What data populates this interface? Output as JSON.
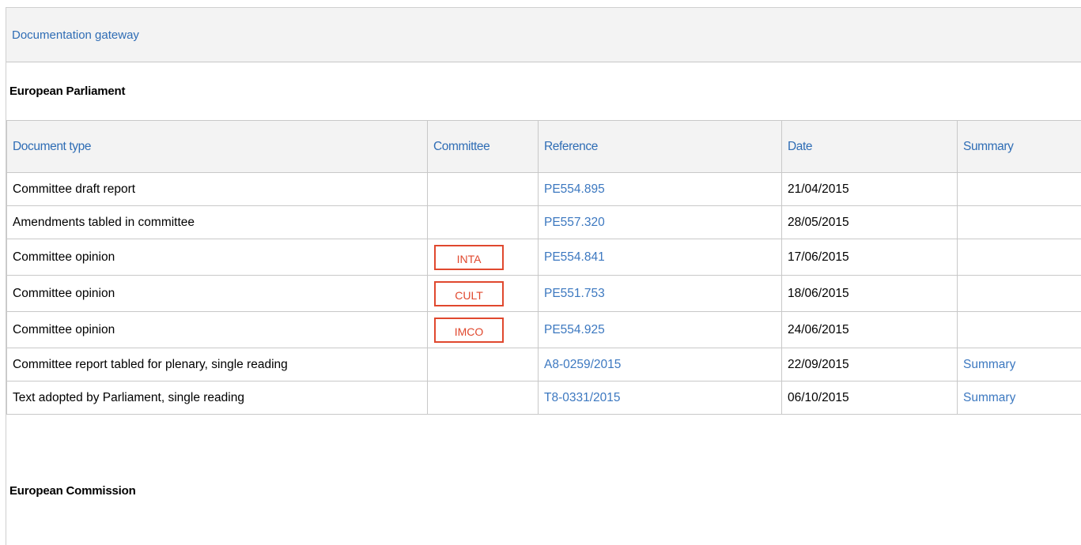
{
  "gateway": {
    "title": "Documentation gateway"
  },
  "european_parliament": {
    "title": "European Parliament",
    "columns": {
      "document_type": "Document type",
      "committee": "Committee",
      "reference": "Reference",
      "date": "Date",
      "summary": "Summary"
    },
    "rows": [
      {
        "document_type": "Committee draft report",
        "committee": "",
        "reference": "PE554.895",
        "date": "21/04/2015",
        "summary": ""
      },
      {
        "document_type": "Amendments tabled in committee",
        "committee": "",
        "reference": "PE557.320",
        "date": "28/05/2015",
        "summary": ""
      },
      {
        "document_type": "Committee opinion",
        "committee": "INTA",
        "reference": "PE554.841",
        "date": "17/06/2015",
        "summary": ""
      },
      {
        "document_type": "Committee opinion",
        "committee": "CULT",
        "reference": "PE551.753",
        "date": "18/06/2015",
        "summary": ""
      },
      {
        "document_type": "Committee opinion",
        "committee": "IMCO",
        "reference": "PE554.925",
        "date": "24/06/2015",
        "summary": ""
      },
      {
        "document_type": "Committee report tabled for plenary, single reading",
        "committee": "",
        "reference": "A8-0259/2015",
        "date": "22/09/2015",
        "summary": "Summary"
      },
      {
        "document_type": "Text adopted by Parliament, single reading",
        "committee": "",
        "reference": "T8-0331/2015",
        "date": "06/10/2015",
        "summary": "Summary"
      }
    ]
  },
  "european_commission": {
    "title": "European Commission"
  },
  "colors": {
    "link": "#2f6db5",
    "badge": "#e0482e",
    "header_bg": "#f3f3f3",
    "border": "#c8c8c8"
  }
}
